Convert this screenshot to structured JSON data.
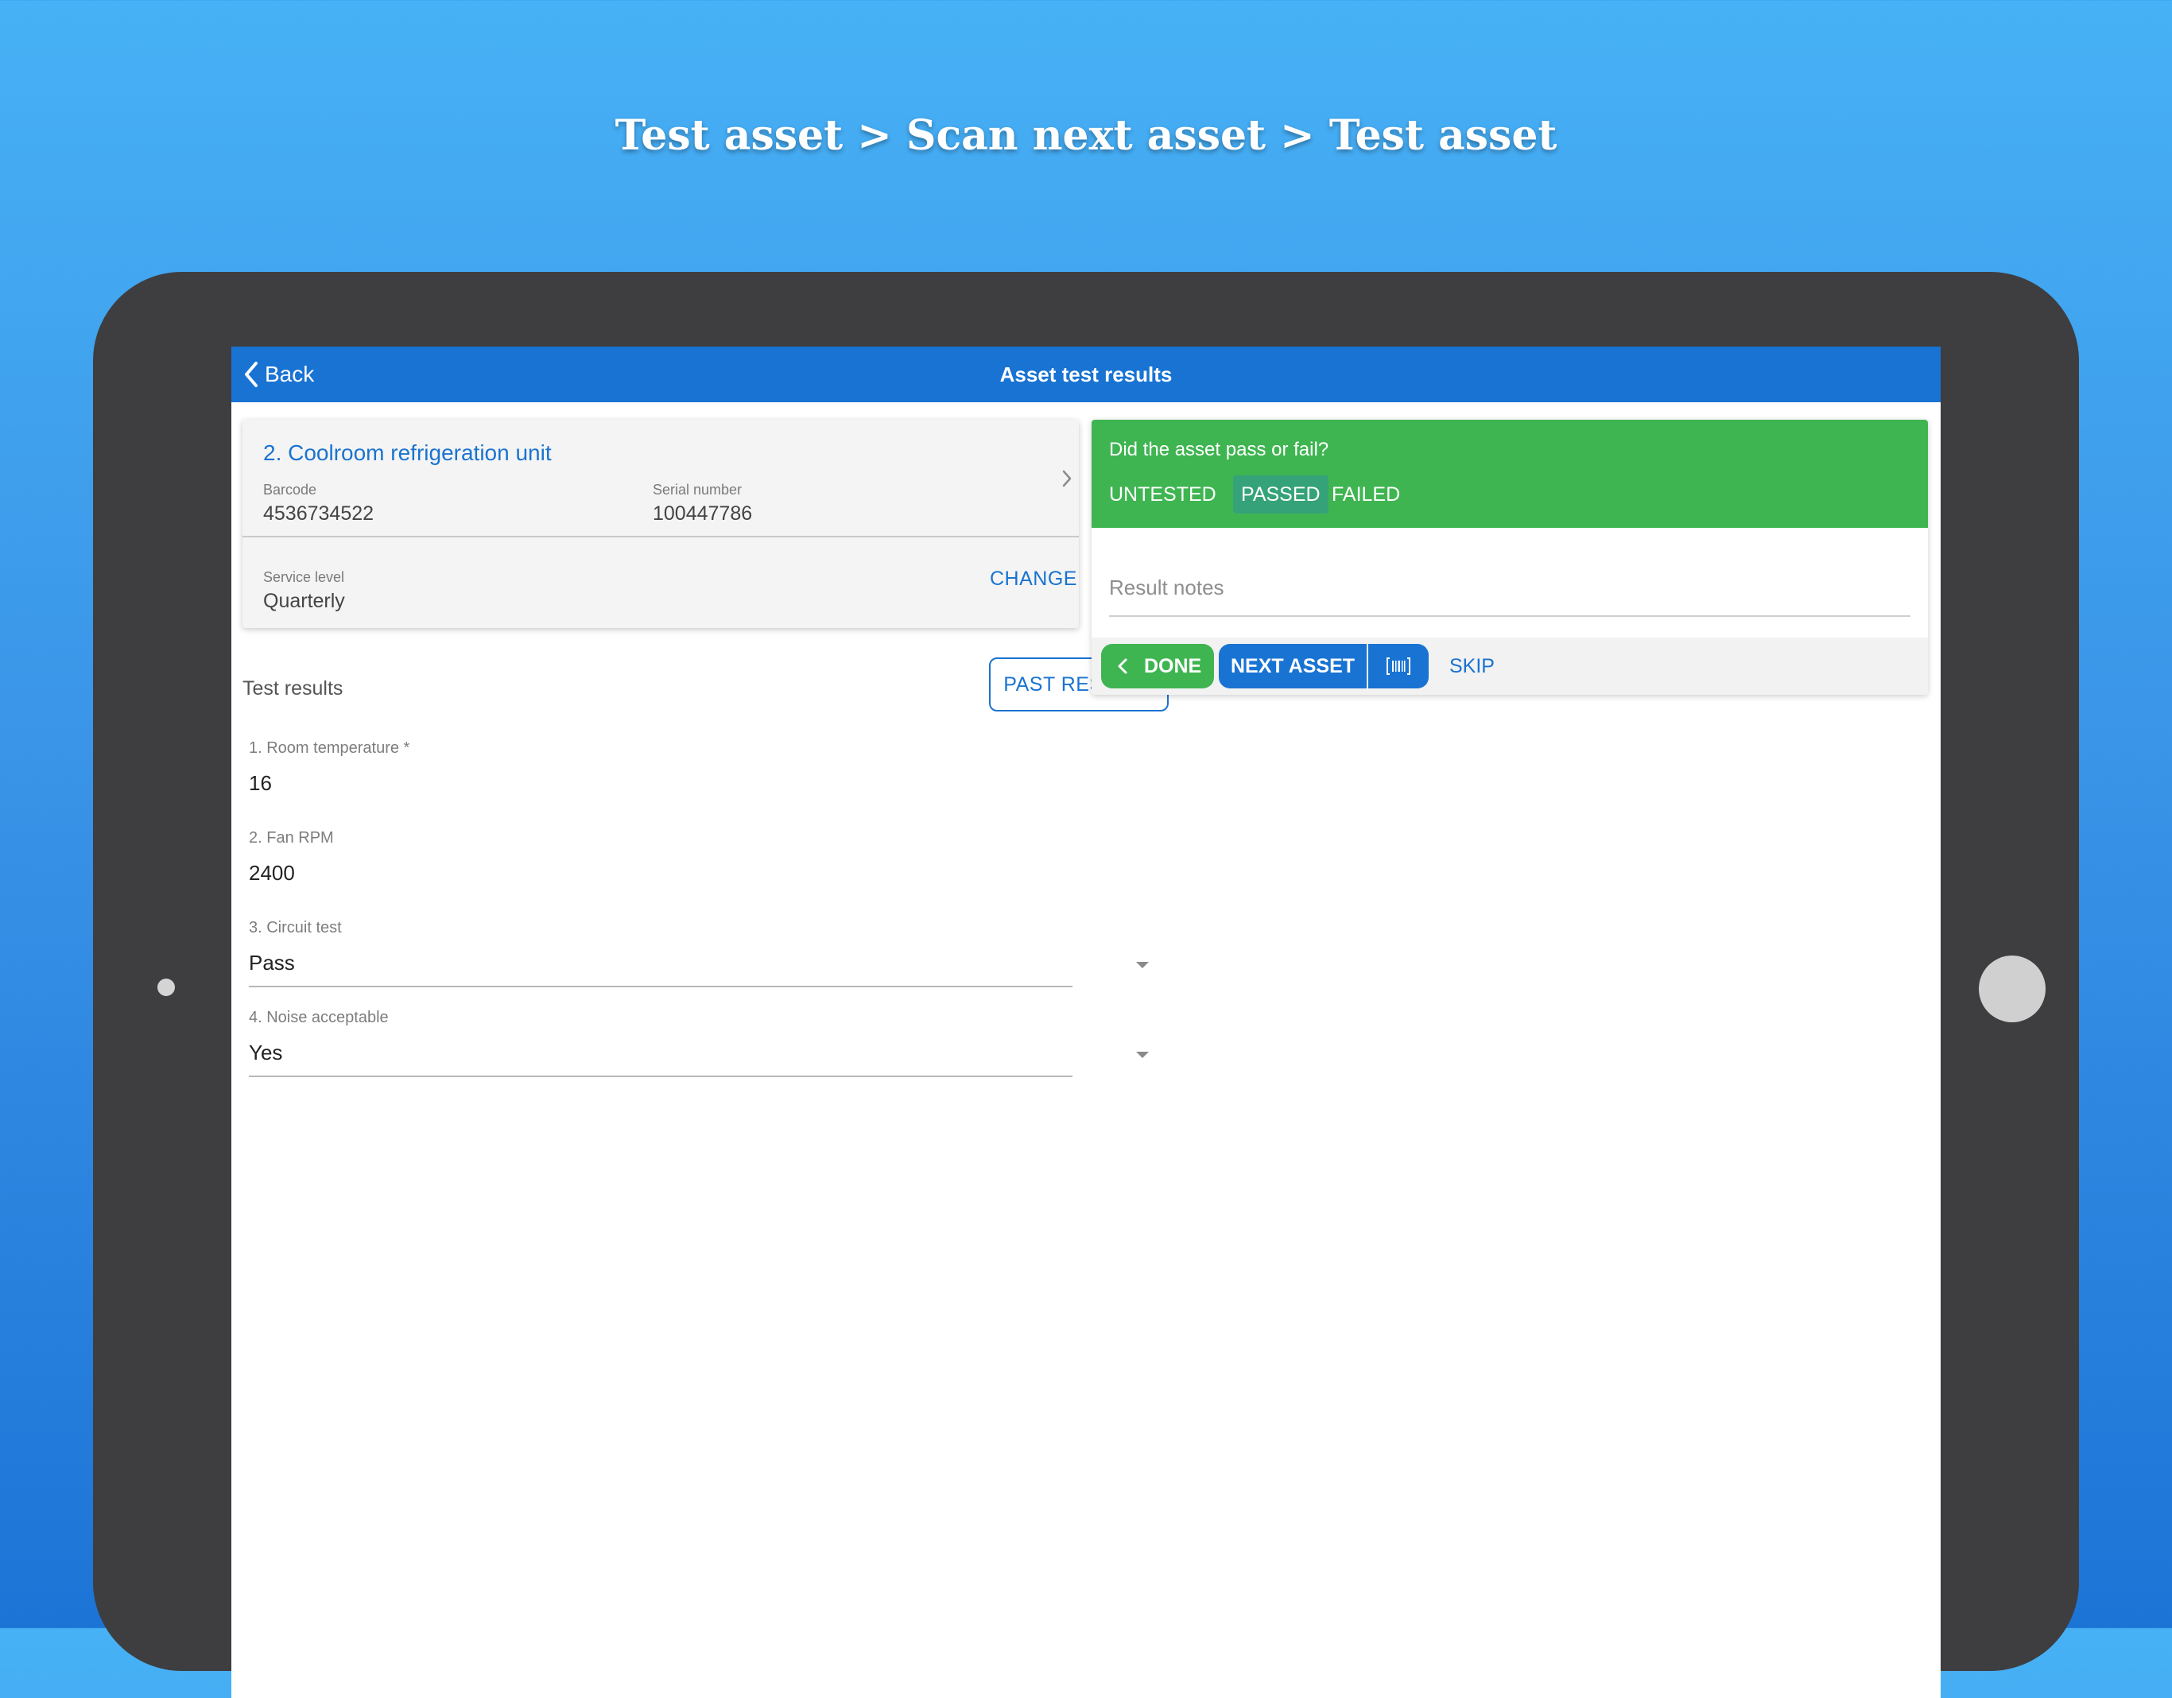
{
  "headline": "Test asset > Scan next asset > Test asset",
  "nav": {
    "back_label": "Back",
    "title": "Asset test results"
  },
  "asset": {
    "name": "2. Coolroom refrigeration unit",
    "barcode_label": "Barcode",
    "barcode": "4536734522",
    "serial_label": "Serial number",
    "serial": "100447786",
    "service_level_label": "Service level",
    "service_level": "Quarterly",
    "change_label": "CHANGE"
  },
  "tests": {
    "section_title": "Test results",
    "past_results_label": "PAST RESULTS",
    "fields": [
      {
        "label": "1. Room temperature *",
        "value": "16"
      },
      {
        "label": "2. Fan RPM",
        "value": "2400"
      },
      {
        "label": "3. Circuit test",
        "value": "Pass"
      },
      {
        "label": "4. Noise acceptable",
        "value": "Yes"
      }
    ]
  },
  "result": {
    "question": "Did the asset pass or fail?",
    "options": [
      "UNTESTED",
      "PASSED",
      "FAILED"
    ],
    "selected": "PASSED",
    "notes_placeholder": "Result notes",
    "done_label": "DONE",
    "next_label": "NEXT ASSET",
    "skip_label": "SKIP"
  },
  "colors": {
    "primary_blue": "#1873d3",
    "pass_green": "#3fb551",
    "selected_segment": "#35a27a",
    "device_frame": "#3e3e40"
  },
  "icons": [
    "chevron-left-icon",
    "chevron-right-icon",
    "barcode-icon",
    "dropdown-caret-icon"
  ]
}
